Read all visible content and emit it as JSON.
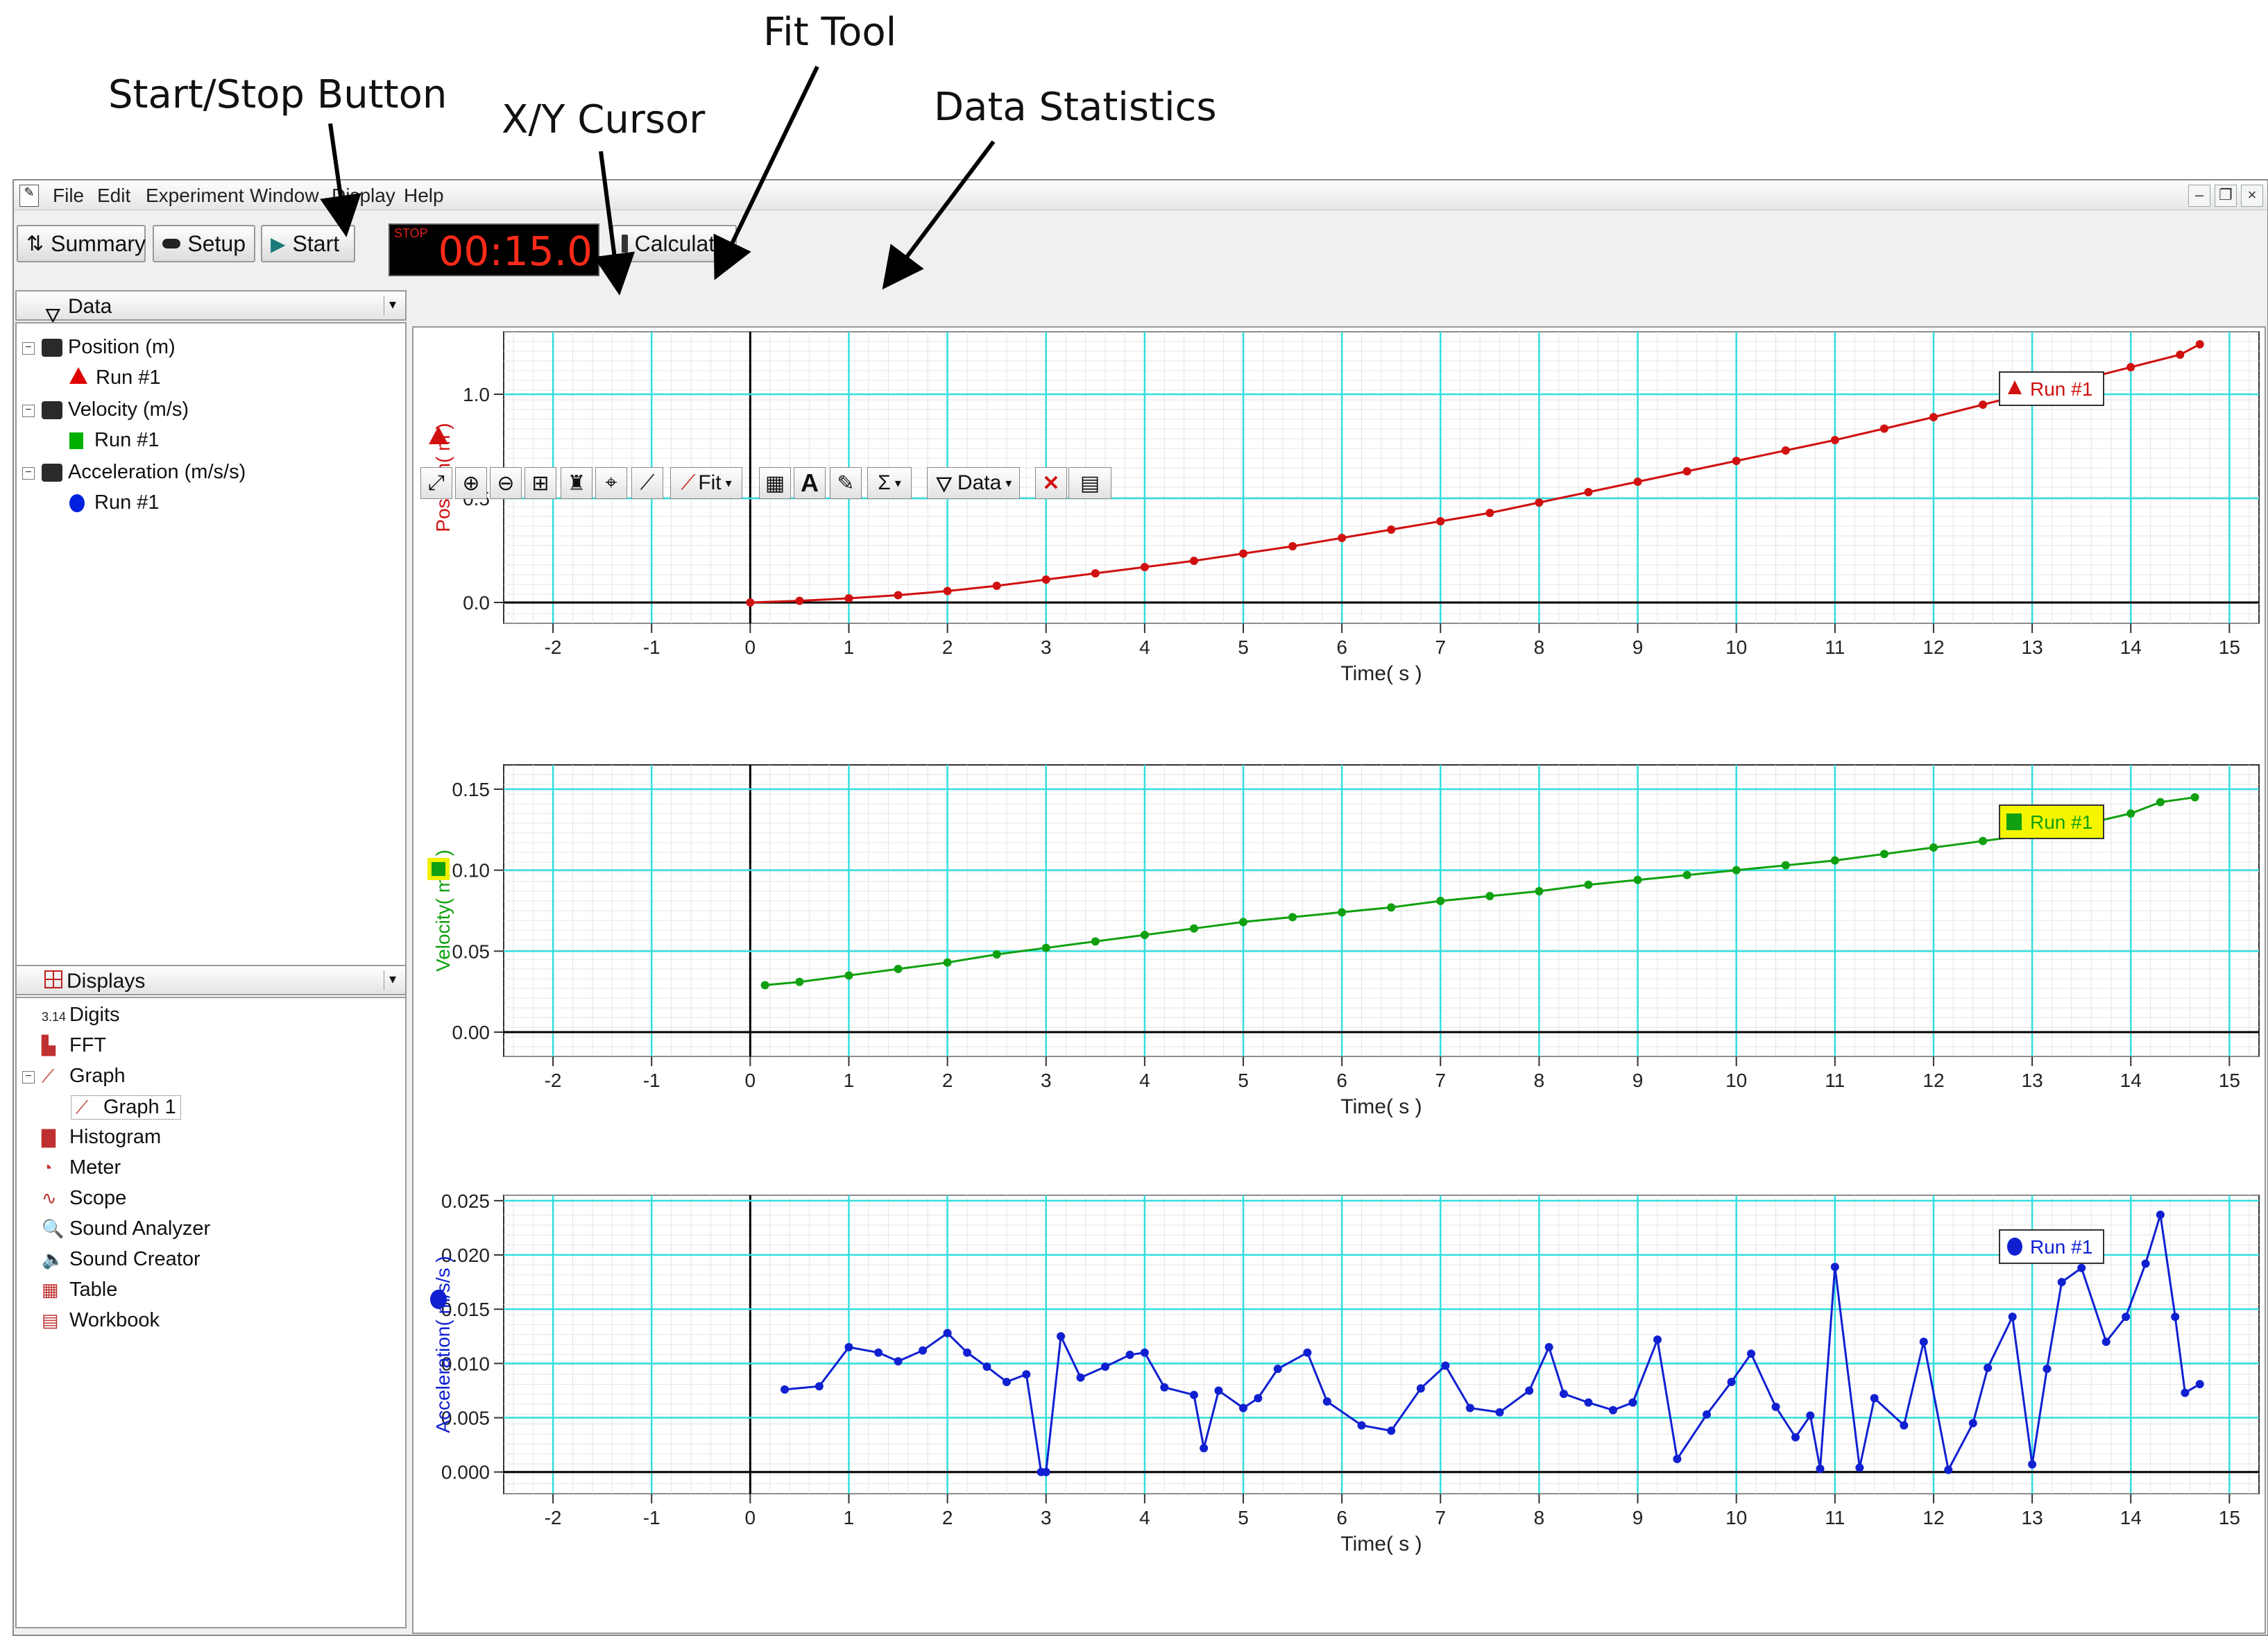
{
  "annotations": {
    "start_stop": "Start/Stop Button",
    "xy_cursor": "X/Y Cursor",
    "fit_tool": "Fit Tool",
    "data_statistics": "Data Statistics"
  },
  "menu": [
    "File",
    "Edit",
    "Experiment",
    "Window",
    "Display",
    "Help"
  ],
  "toolbar": {
    "summary": "Summary",
    "setup": "Setup",
    "start": "Start",
    "timer_state": "STOP",
    "timer_value": "00:15.0",
    "calculate": "Calculate"
  },
  "graph_toolbar": {
    "fit": "Fit",
    "sigma": "Σ",
    "data": "Data",
    "text_tool": "A",
    "delete": "✕"
  },
  "data_panel": {
    "title": "Data",
    "items": [
      {
        "label": "Position (m)",
        "run": "Run #1",
        "color": "#e00000",
        "marker": "triangle"
      },
      {
        "label": "Velocity (m/s)",
        "run": "Run #1",
        "color": "#00b000",
        "marker": "square"
      },
      {
        "label": "Acceleration (m/s/s)",
        "run": "Run #1",
        "color": "#0020e0",
        "marker": "circle"
      }
    ]
  },
  "displays_panel": {
    "title": "Displays",
    "items": [
      {
        "label": "Digits",
        "icon": "digits-icon",
        "glyph": "3.14"
      },
      {
        "label": "FFT",
        "icon": "fft-icon"
      },
      {
        "label": "Graph",
        "icon": "graph-icon"
      },
      {
        "label": "Graph 1",
        "icon": "graph-icon"
      },
      {
        "label": "Histogram",
        "icon": "histogram-icon"
      },
      {
        "label": "Meter",
        "icon": "meter-icon"
      },
      {
        "label": "Scope",
        "icon": "scope-icon"
      },
      {
        "label": "Sound Analyzer",
        "icon": "sound-analyzer-icon"
      },
      {
        "label": "Sound Creator",
        "icon": "speaker-icon"
      },
      {
        "label": "Table",
        "icon": "table-icon"
      },
      {
        "label": "Workbook",
        "icon": "workbook-icon"
      }
    ]
  },
  "chart_data": [
    {
      "type": "line",
      "xlabel": "Time( s )",
      "ylabel": "Position( m )",
      "legend": "Run #1",
      "color": "#d01010",
      "marker": "triangle",
      "xlim": [
        -2.5,
        15.3
      ],
      "ylim": [
        -0.1,
        1.3
      ],
      "xticks": [
        "-2",
        "-1",
        "0",
        "1",
        "2",
        "3",
        "4",
        "5",
        "6",
        "7",
        "8",
        "9",
        "10",
        "11",
        "12",
        "13",
        "14",
        "15"
      ],
      "yticks": [
        "0.0",
        "0.5",
        "1.0"
      ],
      "x": [
        0,
        0.5,
        1,
        1.5,
        2,
        2.5,
        3,
        3.5,
        4,
        4.5,
        5,
        5.5,
        6,
        6.5,
        7,
        7.5,
        8,
        8.5,
        9,
        9.5,
        10,
        10.5,
        11,
        11.5,
        12,
        12.5,
        13,
        13.5,
        14,
        14.5,
        14.7
      ],
      "y": [
        0,
        0.008,
        0.02,
        0.035,
        0.055,
        0.08,
        0.11,
        0.14,
        0.17,
        0.2,
        0.235,
        0.27,
        0.31,
        0.35,
        0.39,
        0.43,
        0.48,
        0.53,
        0.58,
        0.63,
        0.68,
        0.73,
        0.78,
        0.835,
        0.89,
        0.95,
        1.01,
        1.07,
        1.13,
        1.19,
        1.24
      ]
    },
    {
      "type": "line",
      "xlabel": "Time( s )",
      "ylabel": "Velocity( m/s )",
      "legend": "Run #1",
      "color": "#10a010",
      "marker": "square",
      "xlim": [
        -2.5,
        15.3
      ],
      "ylim": [
        -0.015,
        0.165
      ],
      "xticks": [
        "-2",
        "-1",
        "0",
        "1",
        "2",
        "3",
        "4",
        "5",
        "6",
        "7",
        "8",
        "9",
        "10",
        "11",
        "12",
        "13",
        "14",
        "15"
      ],
      "yticks": [
        "0.00",
        "0.05",
        "0.10",
        "0.15"
      ],
      "x": [
        0.15,
        0.5,
        1,
        1.5,
        2,
        2.5,
        3,
        3.5,
        4,
        4.5,
        5,
        5.5,
        6,
        6.5,
        7,
        7.5,
        8,
        8.5,
        9,
        9.5,
        10,
        10.5,
        11,
        11.5,
        12,
        12.5,
        13,
        13.5,
        14,
        14.3,
        14.65
      ],
      "y": [
        0.029,
        0.031,
        0.035,
        0.039,
        0.043,
        0.048,
        0.052,
        0.056,
        0.06,
        0.064,
        0.068,
        0.071,
        0.074,
        0.077,
        0.081,
        0.084,
        0.087,
        0.091,
        0.094,
        0.097,
        0.1,
        0.103,
        0.106,
        0.11,
        0.114,
        0.118,
        0.122,
        0.128,
        0.135,
        0.142,
        0.145
      ]
    },
    {
      "type": "line",
      "xlabel": "Time( s )",
      "ylabel": "Acceleration( m/s/s )",
      "legend": "Run #1",
      "color": "#1020d0",
      "marker": "circle",
      "xlim": [
        -2.5,
        15.3
      ],
      "ylim": [
        -0.002,
        0.0255
      ],
      "xticks": [
        "-2",
        "-1",
        "0",
        "1",
        "2",
        "3",
        "4",
        "5",
        "6",
        "7",
        "8",
        "9",
        "10",
        "11",
        "12",
        "13",
        "14",
        "15"
      ],
      "yticks": [
        "0.000",
        "0.005",
        "0.010",
        "0.015",
        "0.020",
        "0.025"
      ],
      "x": [
        0.35,
        0.7,
        1,
        1.3,
        1.5,
        1.75,
        2,
        2.2,
        2.4,
        2.6,
        2.8,
        2.95,
        3,
        3.15,
        3.35,
        3.6,
        3.85,
        4,
        4.2,
        4.5,
        4.6,
        4.75,
        5,
        5.15,
        5.35,
        5.65,
        5.85,
        6.2,
        6.5,
        6.8,
        7.05,
        7.3,
        7.6,
        7.9,
        8.1,
        8.25,
        8.5,
        8.75,
        8.95,
        9.2,
        9.4,
        9.7,
        9.95,
        10.15,
        10.4,
        10.6,
        10.75,
        10.85,
        11,
        11.25,
        11.4,
        11.7,
        11.9,
        12.15,
        12.4,
        12.55,
        12.8,
        13,
        13.15,
        13.3,
        13.5,
        13.75,
        13.95,
        14.15,
        14.3,
        14.45,
        14.55,
        14.7
      ],
      "y": [
        0.0076,
        0.0079,
        0.0115,
        0.011,
        0.0102,
        0.0112,
        0.0128,
        0.011,
        0.0097,
        0.0083,
        0.009,
        0,
        0.0,
        0.0125,
        0.0087,
        0.0097,
        0.0108,
        0.011,
        0.0078,
        0.0071,
        0.0022,
        0.0075,
        0.0059,
        0.0068,
        0.0095,
        0.011,
        0.0065,
        0.0043,
        0.0038,
        0.0077,
        0.0098,
        0.0059,
        0.0055,
        0.0075,
        0.0115,
        0.0072,
        0.0064,
        0.0057,
        0.0064,
        0.0122,
        0.0012,
        0.0053,
        0.0083,
        0.0109,
        0.006,
        0.0032,
        0.0052,
        0.0003,
        0.0189,
        0.0004,
        0.0068,
        0.0043,
        0.012,
        0.0002,
        0.0045,
        0.0096,
        0.0143,
        0.0007,
        0.0095,
        0.0175,
        0.0188,
        0.012,
        0.0143,
        0.0192,
        0.0237,
        0.0143,
        0.0073,
        0.0081
      ]
    }
  ]
}
